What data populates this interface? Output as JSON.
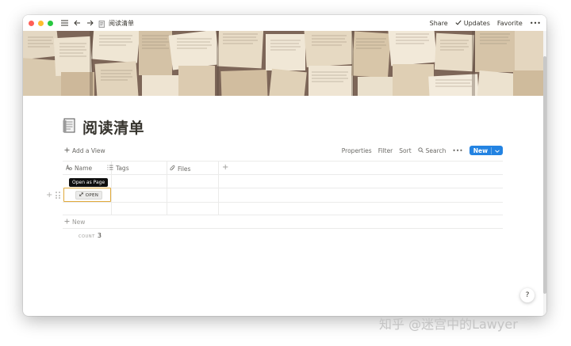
{
  "titlebar": {
    "breadcrumb": "阅读清单",
    "share_label": "Share",
    "updates_label": "Updates",
    "favorite_label": "Favorite",
    "more_label": "•••"
  },
  "page": {
    "title": "阅读清单"
  },
  "viewbar": {
    "add_view_label": "Add a View",
    "properties_label": "Properties",
    "filter_label": "Filter",
    "sort_label": "Sort",
    "search_label": "Search",
    "more_label": "•••",
    "new_label": "New"
  },
  "table": {
    "columns": [
      {
        "label": "Name",
        "icon": "text-icon"
      },
      {
        "label": "Tags",
        "icon": "list-icon"
      },
      {
        "label": "Files",
        "icon": "paperclip-icon"
      }
    ],
    "open_label": "OPEN",
    "tooltip": "Open as Page",
    "new_row_label": "New",
    "count_label": "COUNT",
    "count_value": "3"
  },
  "help_label": "?",
  "watermark": "知乎 @迷宫中的Lawyer",
  "colors": {
    "accent": "#2383e2",
    "selection": "#e0a93a",
    "text": "#37352f",
    "muted": "#9b9a97"
  }
}
